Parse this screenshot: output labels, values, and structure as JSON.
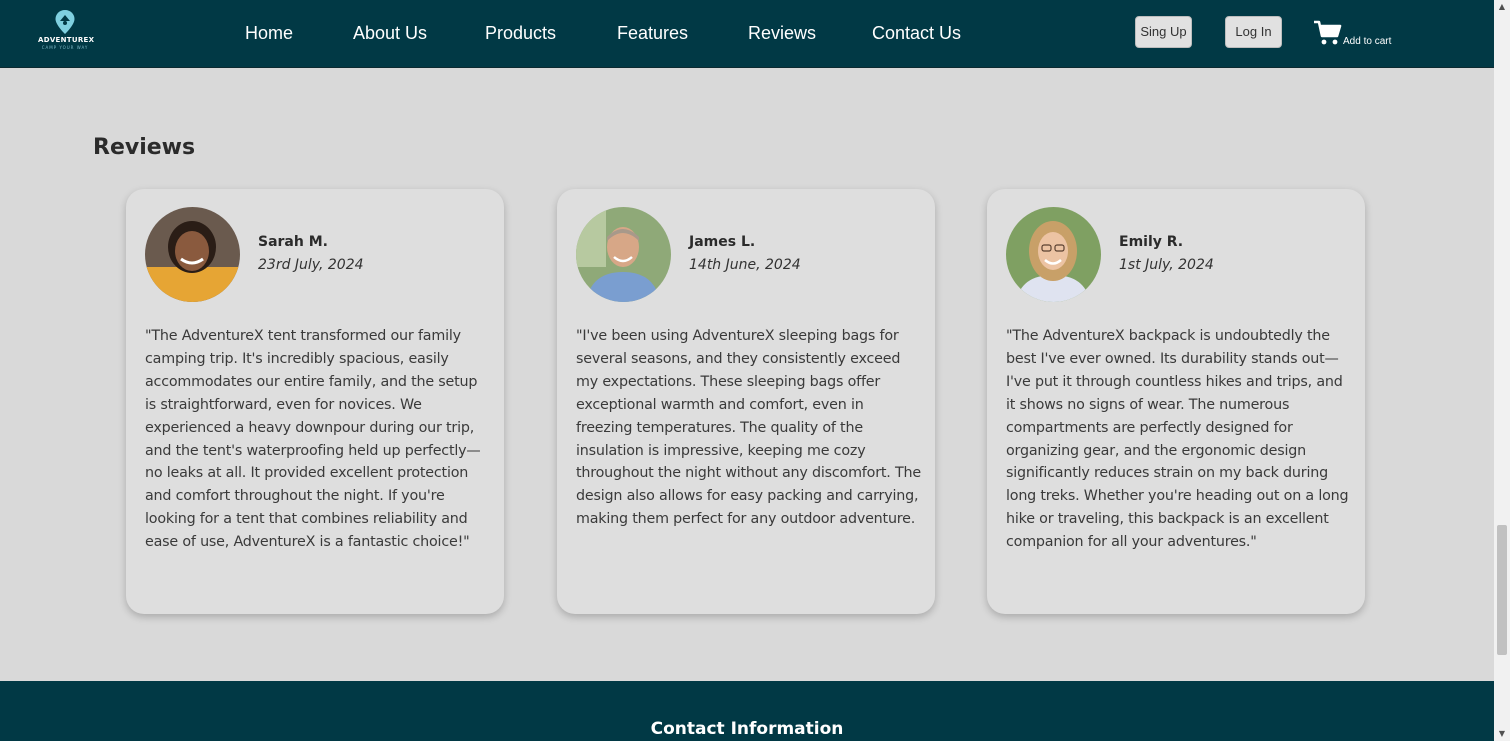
{
  "brand": {
    "name": "ADVENTUREX",
    "tagline": "CAMP YOUR WAY",
    "color_primary": "#013945",
    "color_accent": "#7fd0e0"
  },
  "nav": {
    "links": [
      {
        "label": "Home"
      },
      {
        "label": "About Us"
      },
      {
        "label": "Products"
      },
      {
        "label": "Features"
      },
      {
        "label": "Reviews"
      },
      {
        "label": "Contact Us"
      }
    ],
    "signup_label": "Sing Up",
    "login_label": "Log In",
    "cart_icon": "shopping-cart-icon",
    "cart_label": "Add to cart"
  },
  "reviews": {
    "title": "Reviews",
    "items": [
      {
        "name": "Sarah M.",
        "date": "23rd July, 2024",
        "text": "\"The AdventureX tent transformed our family camping trip. It's incredibly spacious, easily accommodates our entire family, and the setup is straightforward, even for novices. We experienced a heavy downpour during our trip, and the tent's waterproofing held up perfectly—no leaks at all. It provided excellent protection and comfort throughout the night. If you're looking for a tent that combines reliability and ease of use, AdventureX is a fantastic choice!\""
      },
      {
        "name": "James L.",
        "date": "14th June, 2024",
        "text": "\"I've been using AdventureX sleeping bags for several seasons, and they consistently exceed my expectations. These sleeping bags offer exceptional warmth and comfort, even in freezing temperatures. The quality of the insulation is impressive, keeping me cozy throughout the night without any discomfort. The design also allows for easy packing and carrying, making them perfect for any outdoor adventure."
      },
      {
        "name": "Emily R.",
        "date": "1st July, 2024",
        "text": "\"The AdventureX backpack is undoubtedly the best I've ever owned. Its durability stands out—I've put it through countless hikes and trips, and it shows no signs of wear. The numerous compartments are perfectly designed for organizing gear, and the ergonomic design significantly reduces strain on my back during long treks. Whether you're heading out on a long hike or traveling, this backpack is an excellent companion for all your adventures.\""
      }
    ]
  },
  "footer": {
    "title": "Contact Information"
  }
}
